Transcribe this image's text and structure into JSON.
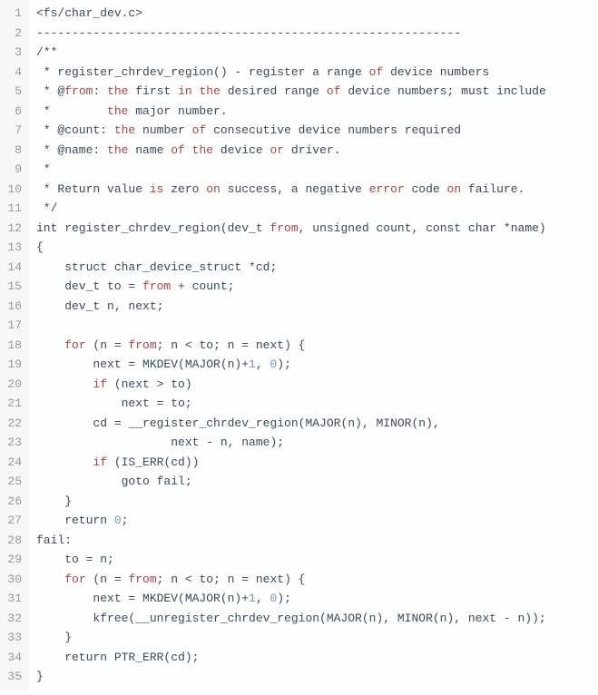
{
  "lines": [
    {
      "n": "1",
      "tokens": [
        {
          "c": "include",
          "t": "<fs/char_dev.c>"
        }
      ]
    },
    {
      "n": "2",
      "tokens": [
        {
          "c": "t-default",
          "t": "------------------------------------------------------------"
        }
      ]
    },
    {
      "n": "3",
      "tokens": [
        {
          "c": "t-default",
          "t": "/**"
        }
      ]
    },
    {
      "n": "4",
      "tokens": [
        {
          "c": "t-default",
          "t": " * register_chrdev_region() - register a range "
        },
        {
          "c": "kw",
          "t": "of"
        },
        {
          "c": "t-default",
          "t": " device numbers"
        }
      ]
    },
    {
      "n": "5",
      "tokens": [
        {
          "c": "t-default",
          "t": " * @"
        },
        {
          "c": "kw",
          "t": "from"
        },
        {
          "c": "t-default",
          "t": ": "
        },
        {
          "c": "kw",
          "t": "the"
        },
        {
          "c": "t-default",
          "t": " first "
        },
        {
          "c": "kw",
          "t": "in"
        },
        {
          "c": "t-default",
          "t": " "
        },
        {
          "c": "kw",
          "t": "the"
        },
        {
          "c": "t-default",
          "t": " desired range "
        },
        {
          "c": "kw",
          "t": "of"
        },
        {
          "c": "t-default",
          "t": " device numbers; must include"
        }
      ]
    },
    {
      "n": "6",
      "tokens": [
        {
          "c": "t-default",
          "t": " *        "
        },
        {
          "c": "kw",
          "t": "the"
        },
        {
          "c": "t-default",
          "t": " major number."
        }
      ]
    },
    {
      "n": "7",
      "tokens": [
        {
          "c": "t-default",
          "t": " * @count: "
        },
        {
          "c": "kw",
          "t": "the"
        },
        {
          "c": "t-default",
          "t": " number "
        },
        {
          "c": "kw",
          "t": "of"
        },
        {
          "c": "t-default",
          "t": " consecutive device numbers required"
        }
      ]
    },
    {
      "n": "8",
      "tokens": [
        {
          "c": "t-default",
          "t": " * @name: "
        },
        {
          "c": "kw",
          "t": "the"
        },
        {
          "c": "t-default",
          "t": " name "
        },
        {
          "c": "kw",
          "t": "of"
        },
        {
          "c": "t-default",
          "t": " "
        },
        {
          "c": "kw",
          "t": "the"
        },
        {
          "c": "t-default",
          "t": " device "
        },
        {
          "c": "kw",
          "t": "or"
        },
        {
          "c": "t-default",
          "t": " driver."
        }
      ]
    },
    {
      "n": "9",
      "tokens": [
        {
          "c": "t-default",
          "t": " *"
        }
      ]
    },
    {
      "n": "10",
      "tokens": [
        {
          "c": "t-default",
          "t": " * Return value "
        },
        {
          "c": "kw",
          "t": "is"
        },
        {
          "c": "t-default",
          "t": " zero "
        },
        {
          "c": "kw",
          "t": "on"
        },
        {
          "c": "t-default",
          "t": " success, a negative "
        },
        {
          "c": "err",
          "t": "error"
        },
        {
          "c": "t-default",
          "t": " code "
        },
        {
          "c": "kw",
          "t": "on"
        },
        {
          "c": "t-default",
          "t": " failure."
        }
      ]
    },
    {
      "n": "11",
      "tokens": [
        {
          "c": "t-default",
          "t": " */"
        }
      ]
    },
    {
      "n": "12",
      "tokens": [
        {
          "c": "t-default",
          "t": "int register_chrdev_region(dev_t "
        },
        {
          "c": "kw",
          "t": "from"
        },
        {
          "c": "t-default",
          "t": ", unsigned count, const char *name)"
        }
      ]
    },
    {
      "n": "13",
      "tokens": [
        {
          "c": "t-default",
          "t": "{"
        }
      ]
    },
    {
      "n": "14",
      "tokens": [
        {
          "c": "t-default",
          "t": "    struct char_device_struct *cd;"
        }
      ]
    },
    {
      "n": "15",
      "tokens": [
        {
          "c": "t-default",
          "t": "    dev_t to = "
        },
        {
          "c": "kw",
          "t": "from"
        },
        {
          "c": "t-default",
          "t": " + count;"
        }
      ]
    },
    {
      "n": "16",
      "tokens": [
        {
          "c": "t-default",
          "t": "    dev_t n, next;"
        }
      ]
    },
    {
      "n": "17",
      "tokens": [
        {
          "c": "t-default",
          "t": ""
        }
      ]
    },
    {
      "n": "18",
      "tokens": [
        {
          "c": "t-default",
          "t": "    "
        },
        {
          "c": "kw",
          "t": "for"
        },
        {
          "c": "t-default",
          "t": " (n = "
        },
        {
          "c": "kw",
          "t": "from"
        },
        {
          "c": "t-default",
          "t": "; n < to; n = next) {"
        }
      ]
    },
    {
      "n": "19",
      "tokens": [
        {
          "c": "t-default",
          "t": "        next = MKDEV(MAJOR(n)+"
        },
        {
          "c": "num",
          "t": "1"
        },
        {
          "c": "t-default",
          "t": ", "
        },
        {
          "c": "num",
          "t": "0"
        },
        {
          "c": "t-default",
          "t": ");"
        }
      ]
    },
    {
      "n": "20",
      "tokens": [
        {
          "c": "t-default",
          "t": "        "
        },
        {
          "c": "kw",
          "t": "if"
        },
        {
          "c": "t-default",
          "t": " (next > to)"
        }
      ]
    },
    {
      "n": "21",
      "tokens": [
        {
          "c": "t-default",
          "t": "            next = to;"
        }
      ]
    },
    {
      "n": "22",
      "tokens": [
        {
          "c": "t-default",
          "t": "        cd = __register_chrdev_region(MAJOR(n), MINOR(n),"
        }
      ]
    },
    {
      "n": "23",
      "tokens": [
        {
          "c": "t-default",
          "t": "                   next - n, name);"
        }
      ]
    },
    {
      "n": "24",
      "tokens": [
        {
          "c": "t-default",
          "t": "        "
        },
        {
          "c": "kw",
          "t": "if"
        },
        {
          "c": "t-default",
          "t": " (IS_ERR(cd))"
        }
      ]
    },
    {
      "n": "25",
      "tokens": [
        {
          "c": "t-default",
          "t": "            goto fail;"
        }
      ]
    },
    {
      "n": "26",
      "tokens": [
        {
          "c": "t-default",
          "t": "    }"
        }
      ]
    },
    {
      "n": "27",
      "tokens": [
        {
          "c": "t-default",
          "t": "    return "
        },
        {
          "c": "num",
          "t": "0"
        },
        {
          "c": "t-default",
          "t": ";"
        }
      ]
    },
    {
      "n": "28",
      "tokens": [
        {
          "c": "t-default",
          "t": "fail:"
        }
      ]
    },
    {
      "n": "29",
      "tokens": [
        {
          "c": "t-default",
          "t": "    to = n;"
        }
      ]
    },
    {
      "n": "30",
      "tokens": [
        {
          "c": "t-default",
          "t": "    "
        },
        {
          "c": "kw",
          "t": "for"
        },
        {
          "c": "t-default",
          "t": " (n = "
        },
        {
          "c": "kw",
          "t": "from"
        },
        {
          "c": "t-default",
          "t": "; n < to; n = next) {"
        }
      ]
    },
    {
      "n": "31",
      "tokens": [
        {
          "c": "t-default",
          "t": "        next = MKDEV(MAJOR(n)+"
        },
        {
          "c": "num",
          "t": "1"
        },
        {
          "c": "t-default",
          "t": ", "
        },
        {
          "c": "num",
          "t": "0"
        },
        {
          "c": "t-default",
          "t": ");"
        }
      ]
    },
    {
      "n": "32",
      "tokens": [
        {
          "c": "t-default",
          "t": "        kfree(__unregister_chrdev_region(MAJOR(n), MINOR(n), next - n));"
        }
      ]
    },
    {
      "n": "33",
      "tokens": [
        {
          "c": "t-default",
          "t": "    }"
        }
      ]
    },
    {
      "n": "34",
      "tokens": [
        {
          "c": "t-default",
          "t": "    return PTR_ERR(cd);"
        }
      ]
    },
    {
      "n": "35",
      "tokens": [
        {
          "c": "t-default",
          "t": "}"
        }
      ]
    }
  ]
}
